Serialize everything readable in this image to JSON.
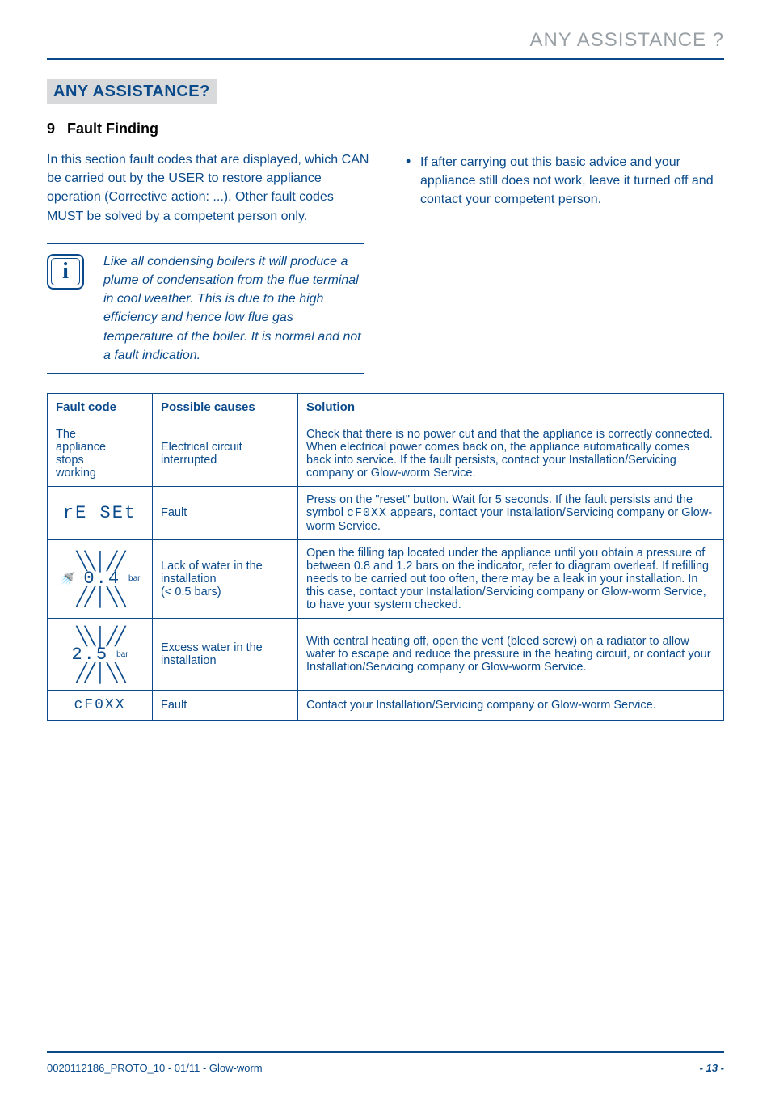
{
  "page": {
    "top_title": "ANY ASSISTANCE ?",
    "section_heading": "ANY ASSISTANCE?",
    "sub_num": "9",
    "sub_text": "Fault Finding",
    "intro": "In this section fault codes that are displayed, which CAN be carried out by the USER to restore appliance operation (Corrective action: ...). Other fault codes MUST be solved by a competent person only.",
    "bullet": "If after carrying out this basic advice and your appliance still does not work, leave it turned off and contact your competent person.",
    "info_icon": "i",
    "info": "Like all condensing boilers it will produce a plume of condensation from the flue terminal in cool weather. This is due to the high efficiency and hence low flue gas temperature of the boiler. It is normal and not a fault indication."
  },
  "table": {
    "headers": {
      "fault": "Fault code",
      "cause": "Possible causes",
      "solution": "Solution"
    },
    "rows": [
      {
        "fault_lines": [
          "The",
          "appliance",
          "stops",
          "working"
        ],
        "cause": "Electrical circuit interrupted",
        "solution": "Check that there is no power cut and that the appliance is correctly connected. When electrical power comes back on, the appliance automatically comes back into service. If the fault persists, contact your Installation/Servicing company or Glow-worm Service."
      },
      {
        "fault_seg": "rE SEt",
        "cause": "Fault",
        "solution_pre": "Press on the \"reset\" button. Wait for 5 seconds. If the fault persists and the symbol ",
        "solution_seg": "cF0XX",
        "solution_post": " appears, contact your Installation/Servicing company or Glow-worm Service."
      },
      {
        "lcd_value": "0.4",
        "lcd_unit": "bar",
        "cause": "Lack of water in the installation\n(< 0.5 bars)",
        "solution": "Open the filling tap located under the appliance until you obtain a pressure of between 0.8 and 1.2 bars on the indicator, refer to diagram overleaf. If refilling needs to be carried out too often, there may be a leak in your installation. In this case, contact your Installation/Servicing company or Glow-worm Service, to have your system checked."
      },
      {
        "lcd_value": "2.5",
        "lcd_unit": "bar",
        "cause": "Excess water in the installation",
        "solution": "With central heating off, open the vent (bleed screw) on a radiator to allow water to escape and reduce the pressure in the heating circuit, or contact your Installation/Servicing company or Glow-worm Service."
      },
      {
        "fault_seg": "cF0XX",
        "cause": "Fault",
        "solution": "Contact your Installation/Servicing company or Glow-worm Service."
      }
    ]
  },
  "footer": {
    "left": "0020112186_PROTO_10 - 01/11 - Glow-worm",
    "right": "- 13 -"
  },
  "chart_data": {
    "type": "table",
    "title": "Fault Finding",
    "columns": [
      "Fault code",
      "Possible causes",
      "Solution"
    ],
    "rows": [
      [
        "The appliance stops working",
        "Electrical circuit interrupted",
        "Check that there is no power cut and that the appliance is correctly connected. When electrical power comes back on, the appliance automatically comes back into service. If the fault persists, contact your Installation/Servicing company or Glow-worm Service."
      ],
      [
        "rE SEt",
        "Fault",
        "Press on the \"reset\" button. Wait for 5 seconds. If the fault persists and the symbol cF0XX appears, contact your Installation/Servicing company or Glow-worm Service."
      ],
      [
        "0.4 bar (flashing)",
        "Lack of water in the installation (< 0.5 bars)",
        "Open the filling tap located under the appliance until you obtain a pressure of between 0.8 and 1.2 bars on the indicator, refer to diagram overleaf. If refilling needs to be carried out too often, there may be a leak in your installation. In this case, contact your Installation/Servicing company or Glow-worm Service, to have your system checked."
      ],
      [
        "2.5 bar (flashing)",
        "Excess water in the installation",
        "With central heating off, open the vent (bleed screw) on a radiator to allow water to escape and reduce the pressure in the heating circuit, or contact your Installation/Servicing company or Glow-worm Service."
      ],
      [
        "cF0XX",
        "Fault",
        "Contact your Installation/Servicing company or Glow-worm Service."
      ]
    ]
  }
}
